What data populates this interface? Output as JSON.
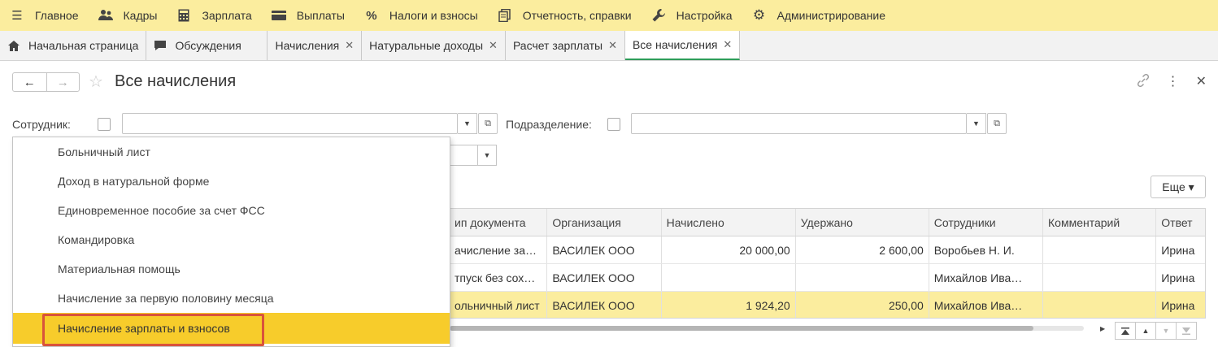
{
  "top_menu": [
    {
      "label": "Главное",
      "icon": "hamburger-menu-icon"
    },
    {
      "label": "Кадры",
      "icon": "people-icon"
    },
    {
      "label": "Зарплата",
      "icon": "calculator-icon"
    },
    {
      "label": "Выплаты",
      "icon": "wallet-icon"
    },
    {
      "label": "Налоги и взносы",
      "icon": "percent-icon"
    },
    {
      "label": "Отчетность, справки",
      "icon": "documents-icon"
    },
    {
      "label": "Настройка",
      "icon": "wrench-icon"
    },
    {
      "label": "Администрирование",
      "icon": "gear-icon"
    }
  ],
  "tabs": [
    {
      "label": "Начальная страница",
      "icon": "home-icon",
      "closable": false
    },
    {
      "label": "Обсуждения",
      "icon": "chat-icon",
      "closable": false
    },
    {
      "label": "Начисления",
      "closable": true
    },
    {
      "label": "Натуральные доходы",
      "closable": true
    },
    {
      "label": "Расчет зарплаты",
      "closable": true
    },
    {
      "label": "Все начисления",
      "closable": true,
      "active": true
    }
  ],
  "form": {
    "title": "Все начисления",
    "back_glyph": "←",
    "forward_glyph": "→"
  },
  "filters": {
    "employee_label": "Сотрудник:",
    "department_label": "Подразделение:"
  },
  "more_button": "Еще ▾",
  "table": {
    "columns": [
      "ип документа",
      "Организация",
      "Начислено",
      "Удержано",
      "Сотрудники",
      "Комментарий",
      "Ответ"
    ],
    "rows": [
      [
        "ачисление за…",
        "ВАСИЛЕК ООО",
        "20 000,00",
        "2 600,00",
        "Воробьев Н. И.",
        "",
        "Ирина"
      ],
      [
        "тпуск без сох…",
        "ВАСИЛЕК ООО",
        "",
        "",
        "Михайлов Ива…",
        "",
        "Ирина"
      ],
      [
        "ольничный лист",
        "ВАСИЛЕК ООО",
        "1 924,20",
        "250,00",
        "Михайлов Ива…",
        "",
        "Ирина"
      ]
    ],
    "selected_row": 2
  },
  "dropdown_items": [
    "Больничный лист",
    "Доход в натуральной форме",
    "Единовременное пособие за счет ФСС",
    "Командировка",
    "Материальная помощь",
    "Начисление за первую половину месяца",
    "Начисление зарплаты и взносов"
  ],
  "highlighted_item": 6,
  "colors": {
    "menu_bg": "#fbed9e",
    "highlight": "#f7cc2b",
    "annotation_frame": "#d9533b",
    "active_tab_accent": "#2e9d5a"
  }
}
